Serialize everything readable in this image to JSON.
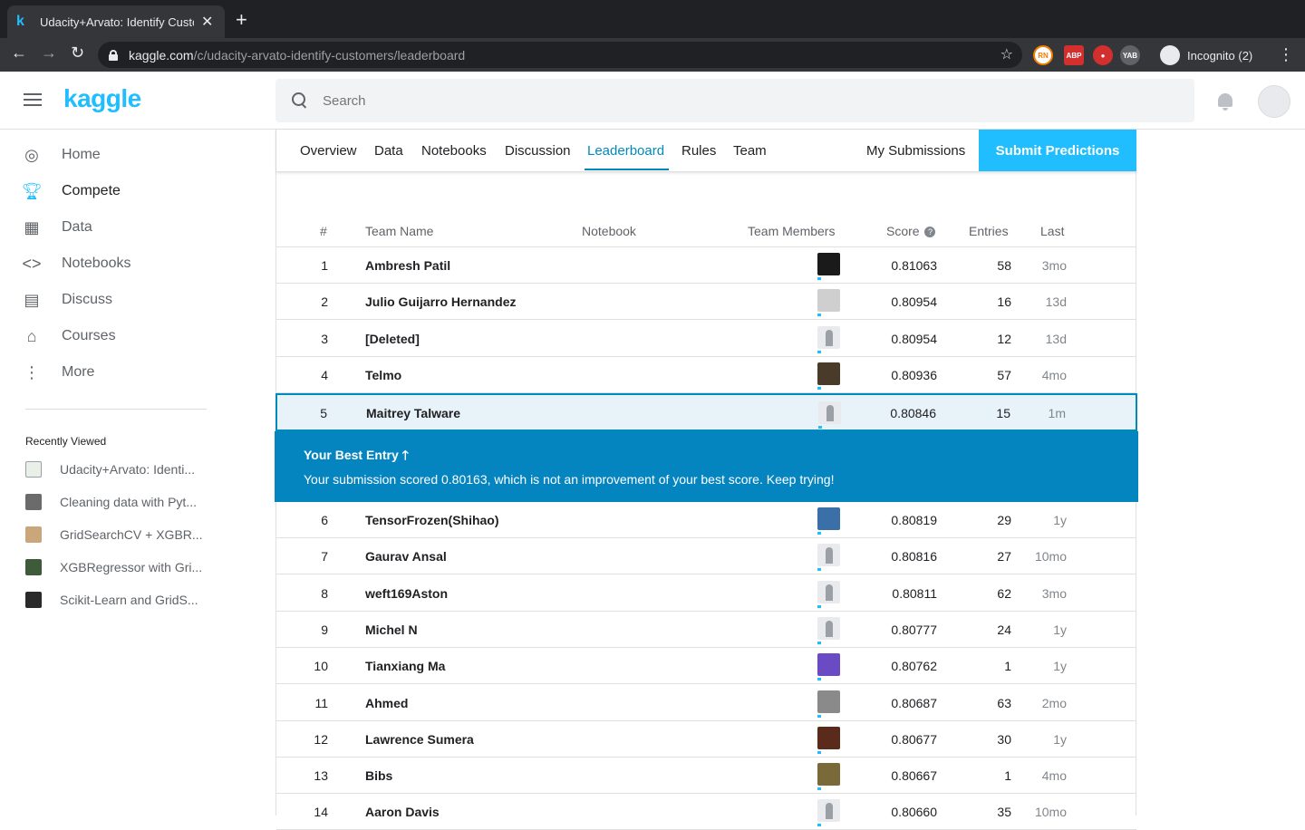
{
  "browser": {
    "tab_title": "Udacity+Arvato: Identify Custo",
    "url_host": "kaggle.com",
    "url_path": "/c/udacity-arvato-identify-customers/leaderboard",
    "profile_label": "Incognito (2)",
    "extensions": [
      "RN",
      "ABP",
      "shield",
      "YAB"
    ]
  },
  "header": {
    "logo": "kaggle",
    "search_placeholder": "Search"
  },
  "sidebar": {
    "items": [
      {
        "label": "Home",
        "icon": "compass-icon"
      },
      {
        "label": "Compete",
        "icon": "trophy-icon"
      },
      {
        "label": "Data",
        "icon": "table-icon"
      },
      {
        "label": "Notebooks",
        "icon": "code-icon"
      },
      {
        "label": "Discuss",
        "icon": "comment-icon"
      },
      {
        "label": "Courses",
        "icon": "graduation-icon"
      },
      {
        "label": "More",
        "icon": "more-vertical-icon"
      }
    ],
    "recent_title": "Recently Viewed",
    "recent": [
      "Udacity+Arvato: Identi...",
      "Cleaning data with Pyt...",
      "GridSearchCV + XGBR...",
      "XGBRegressor with Gri...",
      "Scikit-Learn and GridS..."
    ]
  },
  "competition_tabs": {
    "items": [
      "Overview",
      "Data",
      "Notebooks",
      "Discussion",
      "Leaderboard",
      "Rules",
      "Team"
    ],
    "active": "Leaderboard",
    "my_submissions": "My Submissions",
    "submit": "Submit Predictions"
  },
  "leaderboard": {
    "columns": [
      "#",
      "Team Name",
      "Notebook",
      "Team Members",
      "Score",
      "Entries",
      "Last"
    ],
    "rows_top": [
      {
        "rank": "1",
        "team": "Ambresh Patil",
        "score": "0.81063",
        "entries": "58",
        "last": "3mo",
        "avatar_color": "#1a1a1a"
      },
      {
        "rank": "2",
        "team": "Julio Guijarro Hernandez",
        "score": "0.80954",
        "entries": "16",
        "last": "13d",
        "avatar_color": "#cfcfcf"
      },
      {
        "rank": "3",
        "team": "[Deleted]",
        "score": "0.80954",
        "entries": "12",
        "last": "13d",
        "avatar_color": "ghost"
      },
      {
        "rank": "4",
        "team": "Telmo",
        "score": "0.80936",
        "entries": "57",
        "last": "4mo",
        "avatar_color": "#4a3a2a"
      }
    ],
    "my_row": {
      "rank": "5",
      "team": "Maitrey Talware",
      "score": "0.80846",
      "entries": "15",
      "last": "1m",
      "avatar_color": "ghost"
    },
    "best_entry": {
      "title": "Your Best Entry",
      "message": "Your submission scored 0.80163, which is not an improvement of your best score. Keep trying!"
    },
    "rows_rest": [
      {
        "rank": "6",
        "team": "TensorFrozen(Shihao)",
        "score": "0.80819",
        "entries": "29",
        "last": "1y",
        "avatar_color": "#3a6fa8"
      },
      {
        "rank": "7",
        "team": "Gaurav Ansal",
        "score": "0.80816",
        "entries": "27",
        "last": "10mo",
        "avatar_color": "ghost"
      },
      {
        "rank": "8",
        "team": "weft169Aston",
        "score": "0.80811",
        "entries": "62",
        "last": "3mo",
        "avatar_color": "ghost"
      },
      {
        "rank": "9",
        "team": "Michel N",
        "score": "0.80777",
        "entries": "24",
        "last": "1y",
        "avatar_color": "ghost"
      },
      {
        "rank": "10",
        "team": "Tianxiang Ma",
        "score": "0.80762",
        "entries": "1",
        "last": "1y",
        "avatar_color": "#6a4bc4"
      },
      {
        "rank": "11",
        "team": "Ahmed",
        "score": "0.80687",
        "entries": "63",
        "last": "2mo",
        "avatar_color": "#8a8a8a"
      },
      {
        "rank": "12",
        "team": "Lawrence Sumera",
        "score": "0.80677",
        "entries": "30",
        "last": "1y",
        "avatar_color": "#5a2a1a"
      },
      {
        "rank": "13",
        "team": "Bibs",
        "score": "0.80667",
        "entries": "1",
        "last": "4mo",
        "avatar_color": "#7a6a3a"
      },
      {
        "rank": "14",
        "team": "Aaron Davis",
        "score": "0.80660",
        "entries": "35",
        "last": "10mo",
        "avatar_color": "ghost"
      }
    ]
  }
}
